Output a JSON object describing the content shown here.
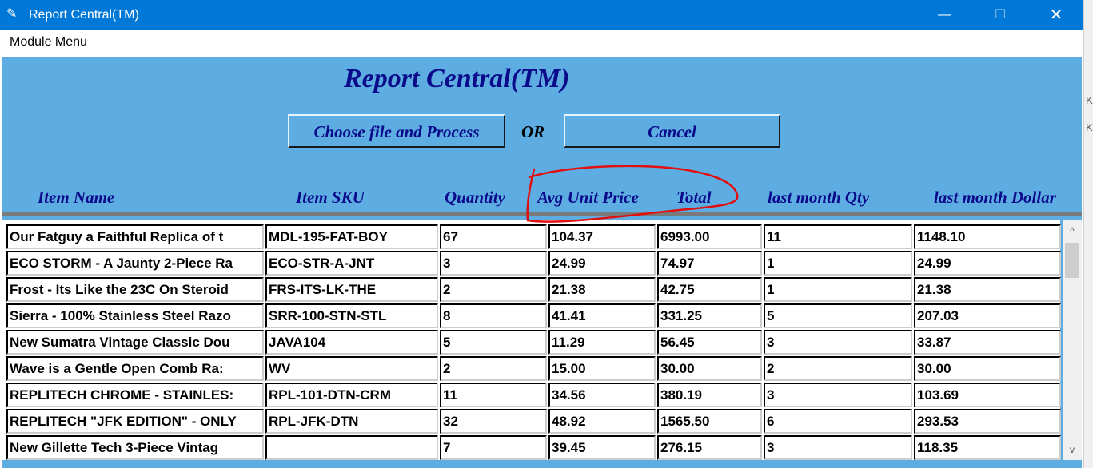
{
  "window": {
    "title": "Report Central(TM)",
    "app_icon": "feather-icon",
    "minimize_icon": "minimize-icon",
    "maximize_icon": "maximize-icon",
    "close_icon": "close-icon",
    "minimize_glyph": "—",
    "maximize_glyph": "☐",
    "close_glyph": "✕"
  },
  "menu": {
    "module_menu": "Module Menu"
  },
  "side_fragments": [
    "KE",
    "KE"
  ],
  "app": {
    "heading": "Report Central(TM)",
    "choose_button": "Choose file and Process",
    "or_label": "OR",
    "cancel_button": "Cancel"
  },
  "columns": [
    "Item Name",
    "Item SKU",
    "Quantity",
    "Avg Unit Price",
    "Total",
    "last month Qty",
    "last month Dollar"
  ],
  "rows": [
    [
      "Our Fatguy a Faithful Replica of t",
      "MDL-195-FAT-BOY",
      "67",
      "104.37",
      "6993.00",
      "11",
      "1148.10"
    ],
    [
      "ECO STORM - A Jaunty 2-Piece Ra",
      "ECO-STR-A-JNT",
      "3",
      "24.99",
      "74.97",
      "1",
      "24.99"
    ],
    [
      "Frost - Its Like the 23C On Steroid",
      "FRS-ITS-LK-THE",
      "2",
      "21.38",
      "42.75",
      "1",
      "21.38"
    ],
    [
      "Sierra - 100% Stainless Steel Razo",
      "SRR-100-STN-STL",
      "8",
      "41.41",
      "331.25",
      "5",
      "207.03"
    ],
    [
      "New Sumatra Vintage Classic Dou",
      "JAVA104",
      "5",
      "11.29",
      "56.45",
      "3",
      "33.87"
    ],
    [
      "Wave is a Gentle Open Comb Ra:",
      "WV",
      "2",
      "15.00",
      "30.00",
      "2",
      "30.00"
    ],
    [
      "REPLITECH CHROME - STAINLES:",
      "RPL-101-DTN-CRM",
      "11",
      "34.56",
      "380.19",
      "3",
      "103.69"
    ],
    [
      "REPLITECH \"JFK EDITION\" - ONLY",
      "RPL-JFK-DTN",
      "32",
      "48.92",
      "1565.50",
      "6",
      "293.53"
    ],
    [
      "New Gillette Tech 3-Piece Vintag",
      "",
      "7",
      "39.45",
      "276.15",
      "3",
      "118.35"
    ]
  ],
  "scrollbar": {
    "up_arrow": "^",
    "down_arrow": "v"
  },
  "annotation": {
    "shape": "hand-drawn-red-loop",
    "color": "#e01010",
    "encircles": "Avg Unit Price / Total headers"
  }
}
